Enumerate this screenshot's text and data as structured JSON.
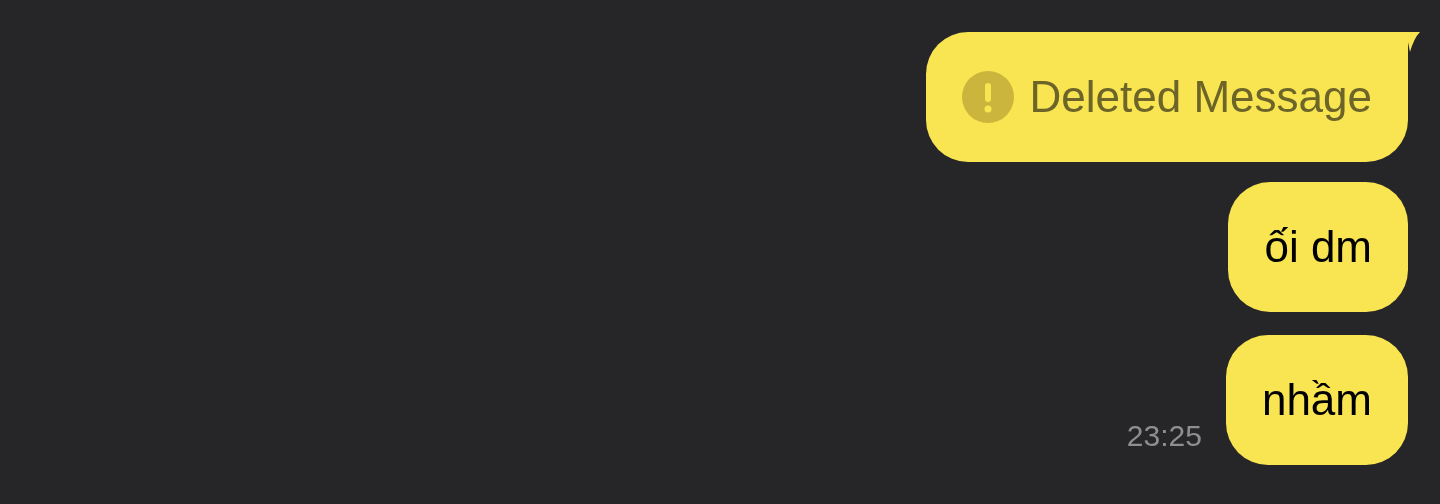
{
  "messages": [
    {
      "kind": "deleted",
      "text": "Deleted Message",
      "tail": true
    },
    {
      "kind": "text",
      "text": "ối dm",
      "tail": false
    },
    {
      "kind": "text",
      "text": "nhầm",
      "tail": false,
      "time": "23:25"
    }
  ]
}
